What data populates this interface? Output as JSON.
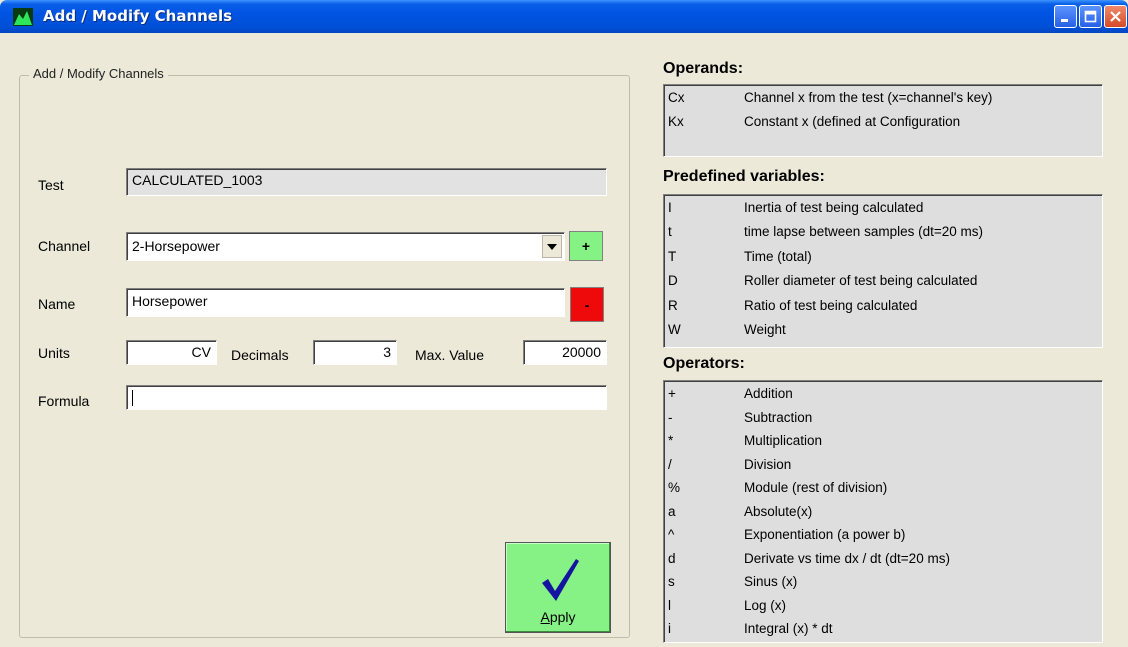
{
  "window": {
    "title": "Add / Modify Channels",
    "buttons": [
      "minimize",
      "maximize",
      "close"
    ]
  },
  "form": {
    "group_title": "Add / Modify Channels",
    "test_label": "Test",
    "test_value": "CALCULATED_1003",
    "channel_label": "Channel",
    "channel_value": "2-Horsepower",
    "add_label": "+",
    "name_label": "Name",
    "name_value": "Horsepower",
    "delete_label": "-",
    "units_label": "Units",
    "units_value": "CV",
    "decimals_label": "Decimals",
    "decimals_value": "3",
    "maxvalue_label": "Max. Value",
    "maxvalue_value": "20000",
    "formula_label": "Formula",
    "formula_value": "",
    "apply_label": "Apply"
  },
  "operands": {
    "title": "Operands:",
    "items": [
      {
        "code": "Cx",
        "desc": "Channel x from the test (x=channel's key)"
      },
      {
        "code": "Kx",
        "desc": "Constant x (defined at Configuration"
      }
    ]
  },
  "variables": {
    "title": "Predefined variables:",
    "items": [
      {
        "code": "I",
        "desc": "Inertia of test being calculated"
      },
      {
        "code": "t",
        "desc": "time lapse between samples (dt=20 ms)"
      },
      {
        "code": "T",
        "desc": "Time (total)"
      },
      {
        "code": "D",
        "desc": "Roller diameter of test being calculated"
      },
      {
        "code": "R",
        "desc": "Ratio of test being calculated"
      },
      {
        "code": "W",
        "desc": "Weight"
      }
    ]
  },
  "operators": {
    "title": "Operators:",
    "items": [
      {
        "code": "+",
        "desc": "Addition"
      },
      {
        "code": "-",
        "desc": "Subtraction"
      },
      {
        "code": "*",
        "desc": "Multiplication"
      },
      {
        "code": "/",
        "desc": "Division"
      },
      {
        "code": "%",
        "desc": "Module (rest of division)"
      },
      {
        "code": "a",
        "desc": "Absolute(x)"
      },
      {
        "code": "^",
        "desc": "Exponentiation (a power b)"
      },
      {
        "code": "d",
        "desc": "Derivate vs time dx / dt (dt=20 ms)"
      },
      {
        "code": "s",
        "desc": "Sinus (x)"
      },
      {
        "code": "l",
        "desc": "Log (x)"
      },
      {
        "code": "i",
        "desc": "Integral (x) * dt"
      }
    ]
  },
  "colors": {
    "titlebar": "#0054e3",
    "window_bg": "#ece9d8",
    "green_button": "#86f286",
    "red_button": "#ee0a0a",
    "checkmark": "#1414a0"
  },
  "icons": {
    "app": "green-chart-icon",
    "apply": "checkmark-icon",
    "dropdown": "chevron-down-icon"
  }
}
